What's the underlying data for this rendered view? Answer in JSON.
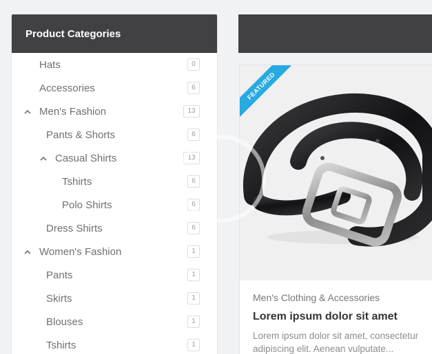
{
  "sidebar": {
    "title": "Product Categories",
    "items": [
      {
        "label": "Hats",
        "count": "0",
        "expandable": false
      },
      {
        "label": "Accessories",
        "count": "6",
        "expandable": false
      },
      {
        "label": "Men's Fashion",
        "count": "13",
        "expandable": true
      },
      {
        "label": "Pants & Shorts",
        "count": "6",
        "expandable": false
      },
      {
        "label": "Casual Shirts",
        "count": "13",
        "expandable": true
      },
      {
        "label": "Tshirts",
        "count": "6",
        "expandable": false
      },
      {
        "label": "Polo Shirts",
        "count": "6",
        "expandable": false
      },
      {
        "label": "Dress Shirts",
        "count": "6",
        "expandable": false
      },
      {
        "label": "Women's Fashion",
        "count": "1",
        "expandable": true
      },
      {
        "label": "Pants",
        "count": "1",
        "expandable": false
      },
      {
        "label": "Skirts",
        "count": "1",
        "expandable": false
      },
      {
        "label": "Blouses",
        "count": "1",
        "expandable": false
      },
      {
        "label": "Tshirts",
        "count": "1",
        "expandable": false
      }
    ]
  },
  "product": {
    "ribbon": "FEATURED",
    "category": "Men's Clothing & Accessories",
    "title": "Lorem ipsum dolor sit amet",
    "description": "Lorem ipsum dolor sit amet, consectetur adipiscing elit. Aenean vulputate...",
    "image_icon": "leather-belt-image"
  },
  "colors": {
    "header_bg": "#414144",
    "ribbon": "#27a9e1",
    "page_bg": "#f1f2f4"
  }
}
